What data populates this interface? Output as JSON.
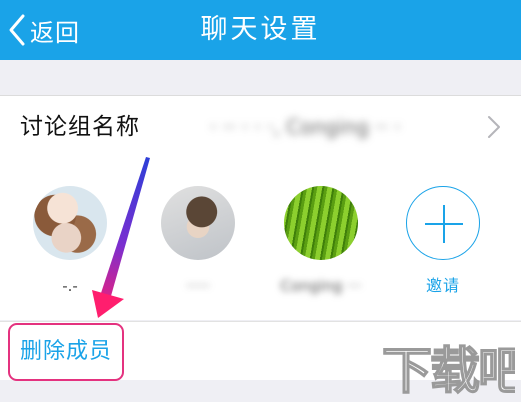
{
  "nav": {
    "back_label": "返回",
    "title": "聊天设置"
  },
  "group_name": {
    "label": "讨论组名称",
    "value": "· ·· · · ·, Conging ·· ·"
  },
  "members": [
    {
      "label": "-.-"
    },
    {
      "label": "·····"
    },
    {
      "label": "Conging ···"
    }
  ],
  "invite": {
    "label": "邀请"
  },
  "delete_members": {
    "label": "删除成员"
  },
  "watermark": {
    "text": "下载吧"
  },
  "colors": {
    "accent": "#1aa3e8",
    "highlight": "#e4327f",
    "background": "#efeff4"
  }
}
